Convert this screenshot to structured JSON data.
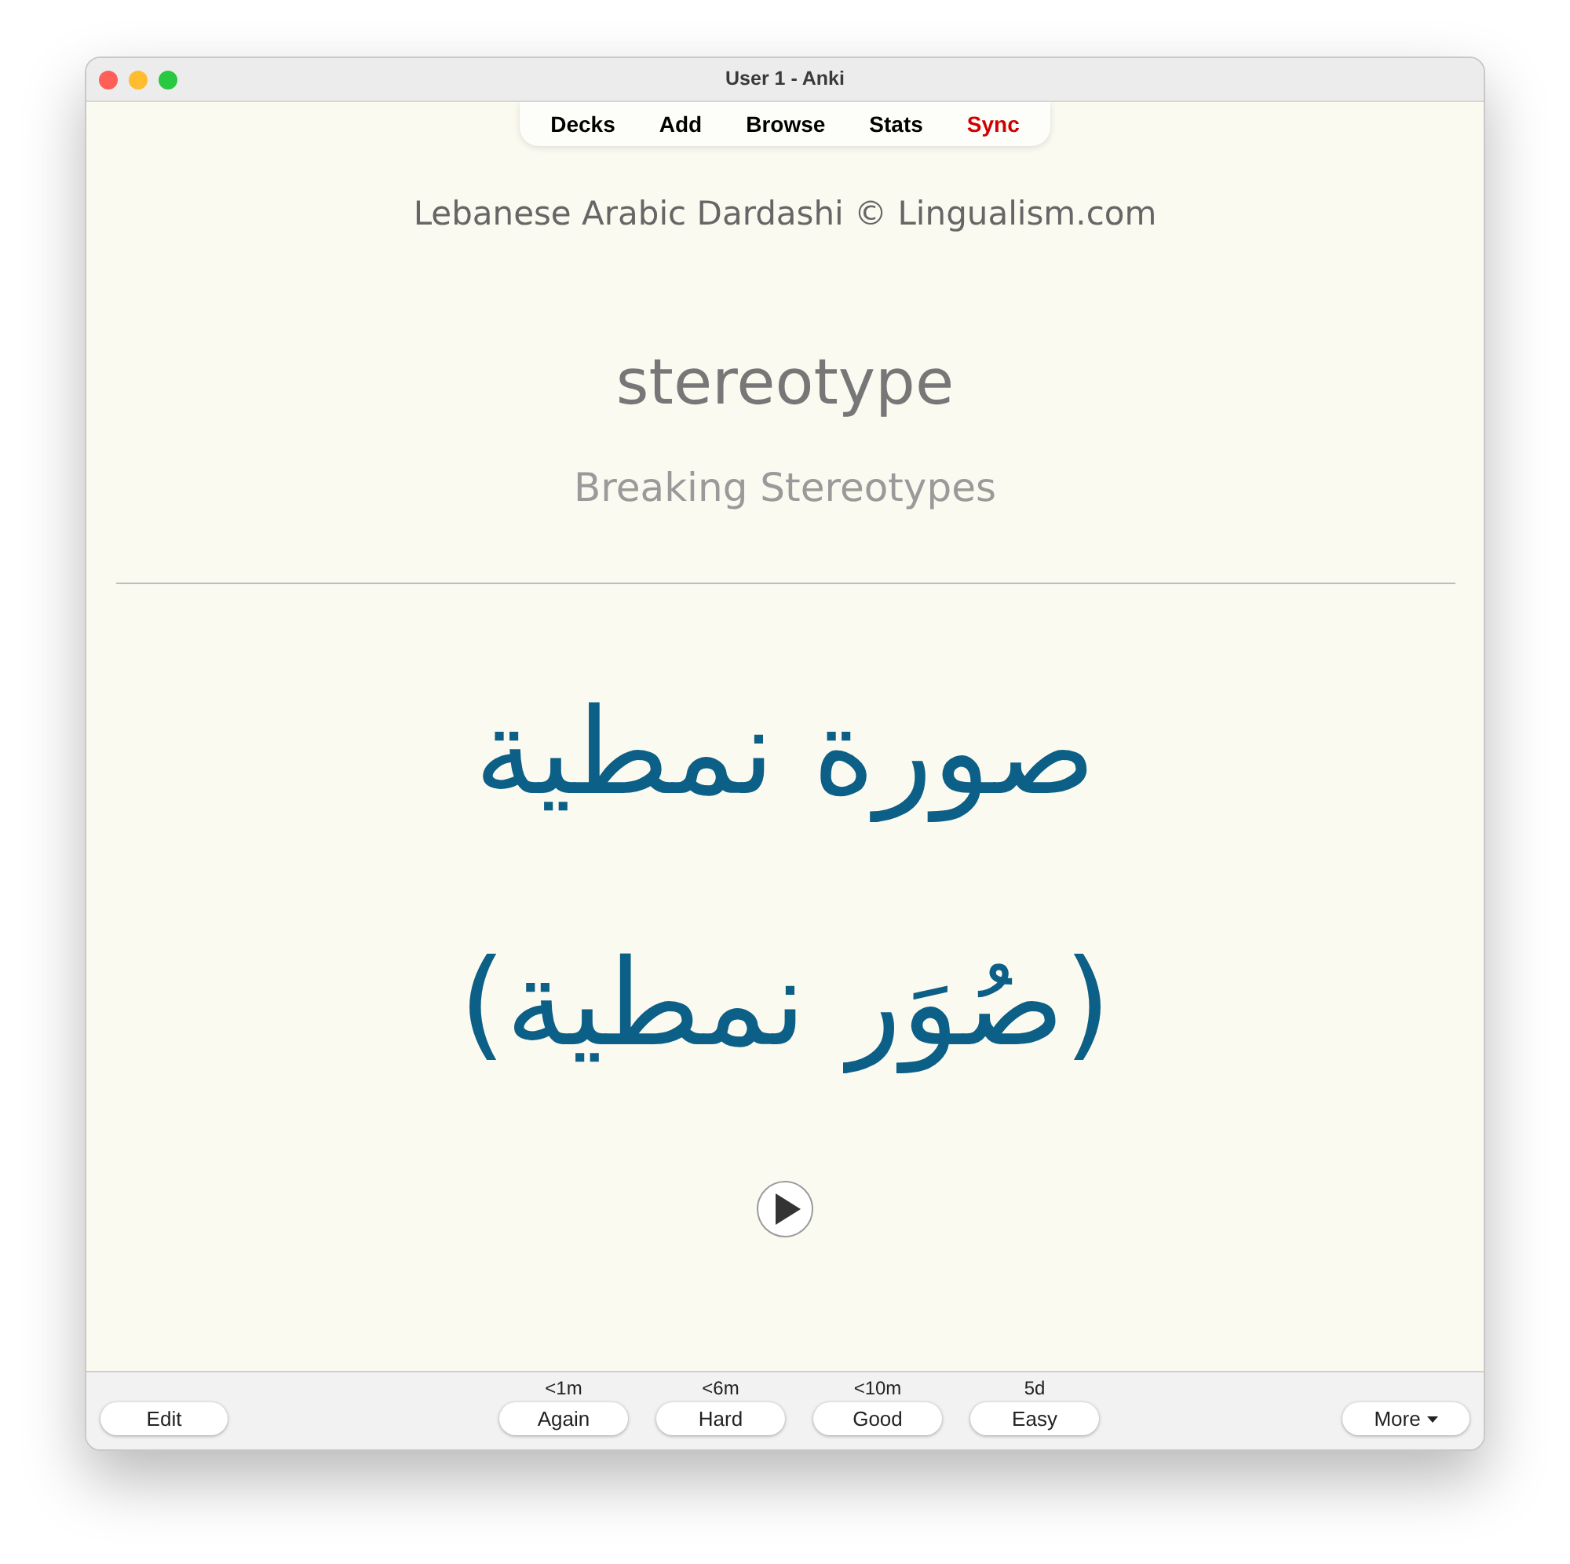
{
  "window": {
    "title": "User 1 - Anki"
  },
  "toolbar": [
    {
      "label": "Decks",
      "color": "#000000"
    },
    {
      "label": "Add",
      "color": "#000000"
    },
    {
      "label": "Browse",
      "color": "#000000"
    },
    {
      "label": "Stats",
      "color": "#000000"
    },
    {
      "label": "Sync",
      "color": "#d00000"
    }
  ],
  "card": {
    "source": "Lebanese Arabic Dardashi © Lingualism.com",
    "word": "stereotype",
    "context": "Breaking Stereotypes",
    "answer_lines": [
      "صورة نمطية",
      "(صُوَر نمطية)"
    ]
  },
  "bottom_bar": {
    "edit_button": "Edit",
    "answer_buttons": [
      {
        "interval": "<1m",
        "label": "Again"
      },
      {
        "interval": "<6m",
        "label": "Hard"
      },
      {
        "interval": "<10m",
        "label": "Good"
      },
      {
        "interval": "5d",
        "label": "Easy"
      }
    ],
    "more_button": "More"
  }
}
